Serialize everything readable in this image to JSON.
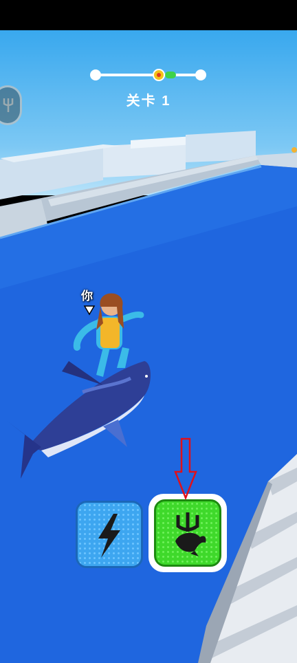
{
  "hud": {
    "level_label": "关卡 1",
    "player_tag": "你"
  },
  "buttons": {
    "speed_icon": "lightning-bolt-icon",
    "power_icon": "trident-shark-icon"
  },
  "colors": {
    "water": "#1f67e0",
    "speed_button": "#3da6f0",
    "power_button": "#3fd92b",
    "annotation_arrow": "#e0101a"
  }
}
